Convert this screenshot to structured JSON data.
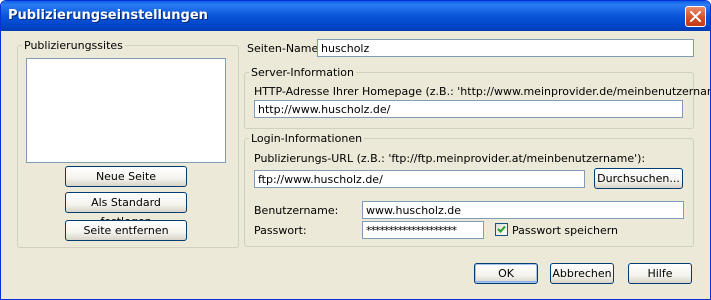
{
  "window": {
    "title": "Publizierungseinstellungen"
  },
  "icons": {
    "close": "close-icon",
    "checkmark": "checkmark-icon"
  },
  "sites": {
    "legend": "Publizierungssites",
    "new_button": "Neue Seite",
    "default_button": "Als Standard festlegen",
    "remove_button": "Seite entfernen"
  },
  "site_name": {
    "label": "Seiten-Name:",
    "value": "huscholz"
  },
  "server": {
    "legend": "Server-Information",
    "url_label": "HTTP-Adresse Ihrer Homepage (z.B.: 'http://www.meinprovider.de/meinbenutzername'):",
    "url_value": "http://www.huscholz.de/"
  },
  "login": {
    "legend": "Login-Informationen",
    "url_label": "Publizierungs-URL (z.B.: 'ftp://ftp.meinprovider.at/meinbenutzername'):",
    "url_value": "ftp://www.huscholz.de/",
    "browse_button": "Durchsuchen...",
    "username_label": "Benutzername:",
    "username_value": "www.huscholz.de",
    "password_label": "Passwort:",
    "password_value": "********************",
    "save_password_label": "Passwort speichern",
    "save_password_checked": true
  },
  "buttons": {
    "ok": "OK",
    "cancel": "Abbrechen",
    "help": "Hilfe"
  },
  "colors": {
    "titlebar": "#0a55d8",
    "close": "#d5512a",
    "face": "#ece9d8",
    "input_border": "#7f9db9"
  }
}
